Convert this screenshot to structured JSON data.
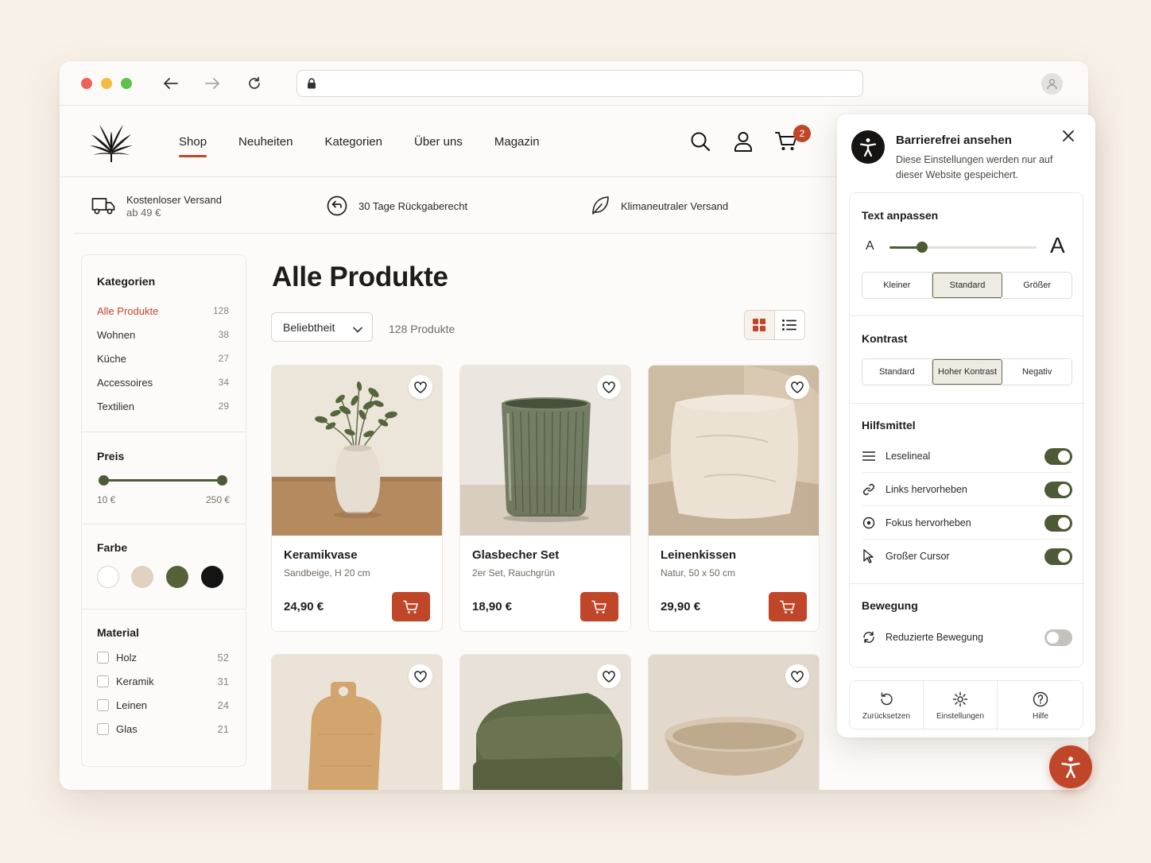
{
  "browser": {
    "url": ""
  },
  "nav": {
    "items": [
      {
        "label": "Shop",
        "active": true
      },
      {
        "label": "Neuheiten"
      },
      {
        "label": "Kategorien"
      },
      {
        "label": "Über uns"
      },
      {
        "label": "Magazin"
      }
    ],
    "cart_count": "2"
  },
  "benefits": [
    {
      "icon": "truck-icon",
      "title": "Kostenloser Versand",
      "sub": "ab 49 €"
    },
    {
      "icon": "return-icon",
      "title": "30 Tage Rückgaberecht"
    },
    {
      "icon": "leaf-icon",
      "title": "Klimaneutraler Versand"
    }
  ],
  "sidebar": {
    "categories_title": "Kategorien",
    "categories": [
      {
        "label": "Alle Produkte",
        "count": "128",
        "active": true
      },
      {
        "label": "Wohnen",
        "count": "38"
      },
      {
        "label": "Küche",
        "count": "27"
      },
      {
        "label": "Accessoires",
        "count": "34"
      },
      {
        "label": "Textilien",
        "count": "29"
      }
    ],
    "price_title": "Preis",
    "price_min": "10 €",
    "price_max": "250 €",
    "color_title": "Farbe",
    "colors": [
      "#ffffff",
      "#e0d1c0",
      "#56613a",
      "#141414"
    ],
    "material_title": "Material",
    "materials": [
      {
        "label": "Holz",
        "count": "52"
      },
      {
        "label": "Keramik",
        "count": "31"
      },
      {
        "label": "Leinen",
        "count": "24"
      },
      {
        "label": "Glas",
        "count": "21"
      }
    ]
  },
  "main": {
    "title": "Alle Produkte",
    "sort_label": "Beliebtheit",
    "product_count": "128 Produkte",
    "products": [
      {
        "name": "Keramikvase",
        "desc": "Sandbeige, H 20 cm",
        "price": "24,90 €"
      },
      {
        "name": "Glasbecher Set",
        "desc": "2er Set, Rauchgrün",
        "price": "18,90 €"
      },
      {
        "name": "Leinenkissen",
        "desc": "Natur, 50 x 50 cm",
        "price": "29,90 €"
      }
    ]
  },
  "a11y": {
    "title": "Barrierefrei ansehen",
    "subtitle": "Diese Einstellungen werden nur auf dieser Website gespeichert.",
    "text_title": "Text anpassen",
    "text_small": "A",
    "text_large": "A",
    "text_level": 0.22,
    "text_sizes": [
      "Kleiner",
      "Standard",
      "Größer"
    ],
    "text_selected": "Standard",
    "contrast_title": "Kontrast",
    "contrast_options": [
      "Standard",
      "Hoher Kontrast",
      "Negativ"
    ],
    "contrast_selected": "Hoher Kontrast",
    "tools_title": "Hilfsmittel",
    "tools": [
      {
        "label": "Leselineal",
        "icon": "reading-ruler-icon",
        "on": true
      },
      {
        "label": "Links hervorheben",
        "icon": "link-icon",
        "on": true
      },
      {
        "label": "Fokus hervorheben",
        "icon": "focus-icon",
        "on": true
      },
      {
        "label": "Großer Cursor",
        "icon": "cursor-icon",
        "on": true
      }
    ],
    "motion_title": "Bewegung",
    "motion": {
      "label": "Reduzierte Bewegung",
      "on": false
    },
    "footer": [
      {
        "label": "Zurücksetzen",
        "icon": "reset-icon"
      },
      {
        "label": "Einstellungen",
        "icon": "settings-gear-icon"
      },
      {
        "label": "Hilfe",
        "icon": "help-icon"
      }
    ]
  },
  "colors": {
    "accent": "#c0462a",
    "olive": "#4c5a35"
  }
}
